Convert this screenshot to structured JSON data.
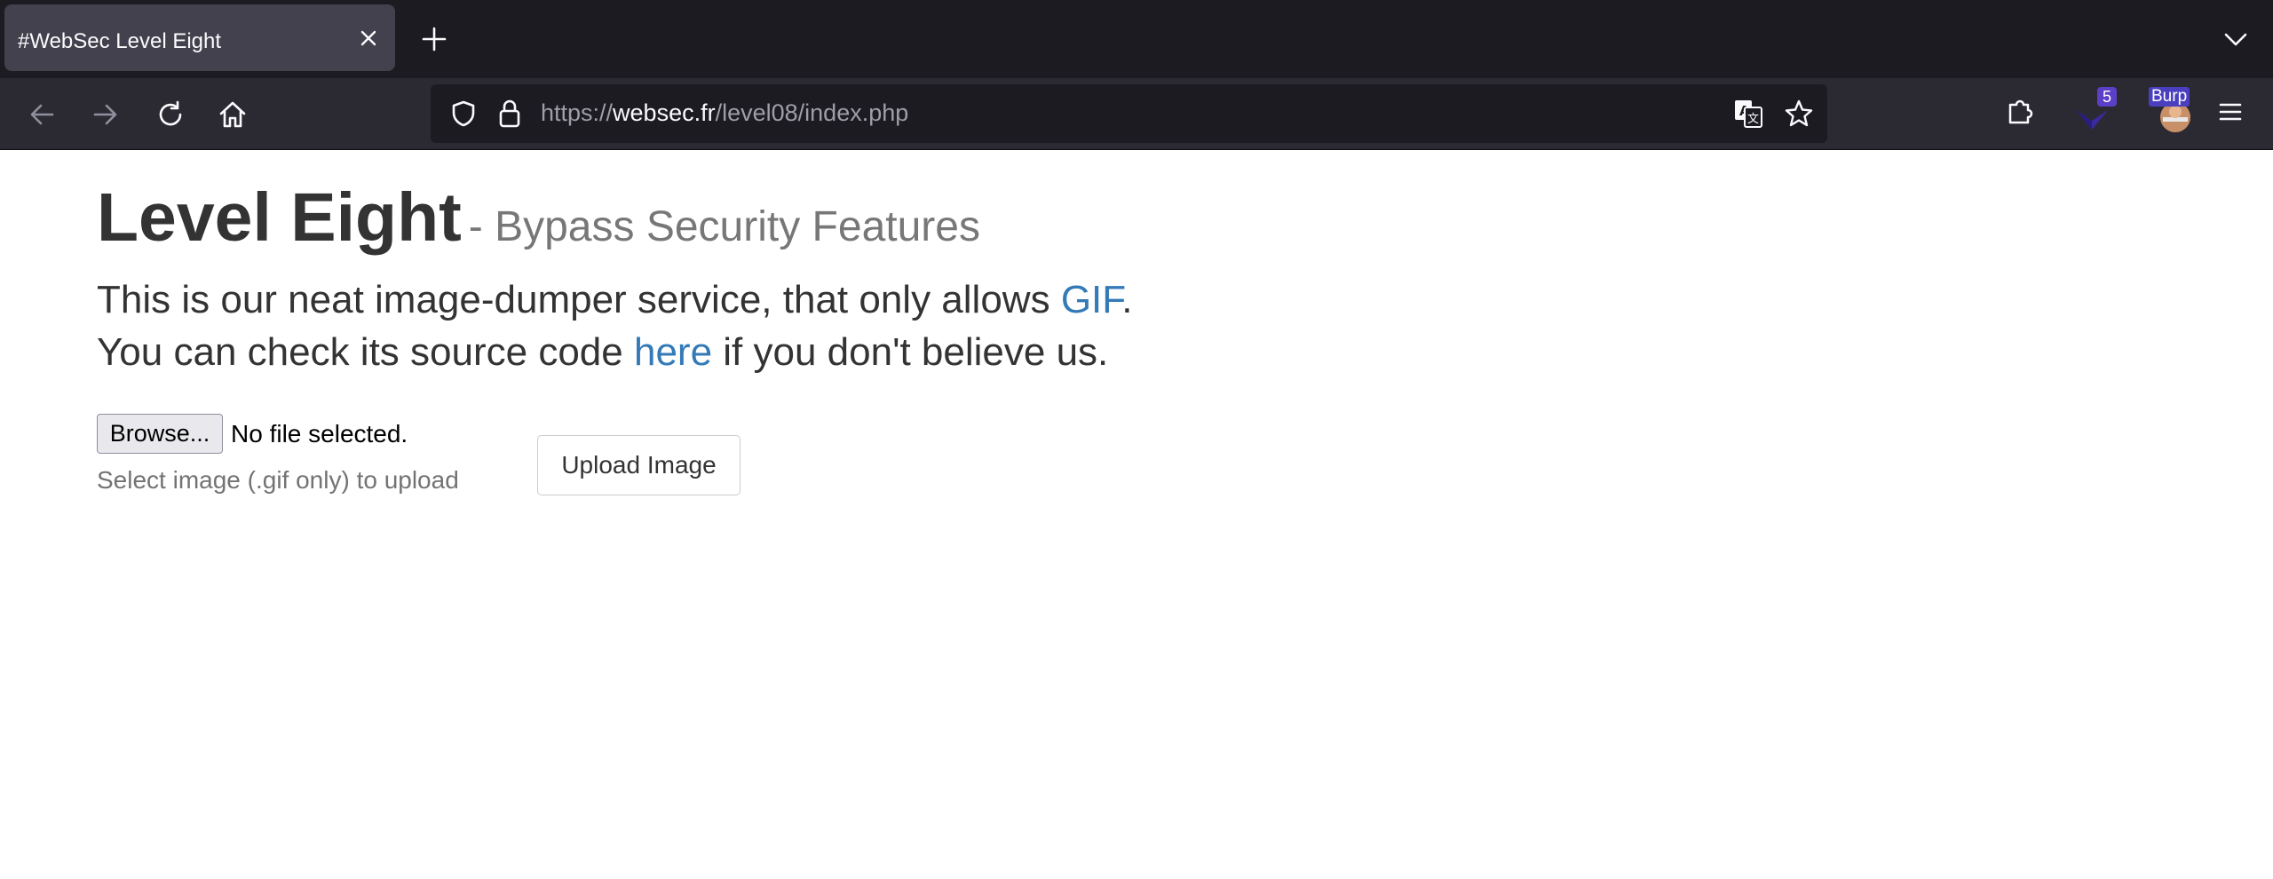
{
  "browser": {
    "tab_title": "#WebSec Level Eight",
    "url_scheme": "https://",
    "url_host": "websec.fr",
    "url_path": "/level08/index.php",
    "extension_badge_count": "5",
    "burp_label": "Burp"
  },
  "page": {
    "title": "Level Eight",
    "subtitle": "- Bypass Security Features",
    "line1_text": "This is our neat image-dumper service, that only allows ",
    "line1_link": "GIF",
    "line1_end": ".",
    "line2_text": "You can check its source code ",
    "line2_link": "here",
    "line2_end": " if you don't believe us.",
    "browse_label": "Browse...",
    "file_status": "No file selected.",
    "help_text": "Select image (.gif only) to upload",
    "upload_label": "Upload Image"
  },
  "colors": {
    "link": "#337ab7",
    "chrome_dark": "#1c1b22",
    "chrome_toolbar": "#2b2a33",
    "tab_active": "#42414d"
  }
}
